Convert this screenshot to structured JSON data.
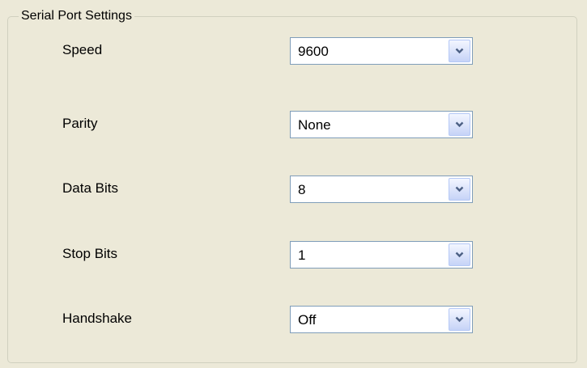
{
  "group": {
    "title": "Serial Port Settings"
  },
  "settings": [
    {
      "label": "Speed",
      "value": "9600"
    },
    {
      "label": "Parity",
      "value": "None"
    },
    {
      "label": "Data Bits",
      "value": "8"
    },
    {
      "label": "Stop Bits",
      "value": "1"
    },
    {
      "label": "Handshake",
      "value": "Off"
    }
  ],
  "icons": {
    "dropdown": "chevron-down-icon"
  },
  "colors": {
    "background": "#ece9d8",
    "combo_border": "#7f9db9",
    "arrow": "#4d6185"
  }
}
